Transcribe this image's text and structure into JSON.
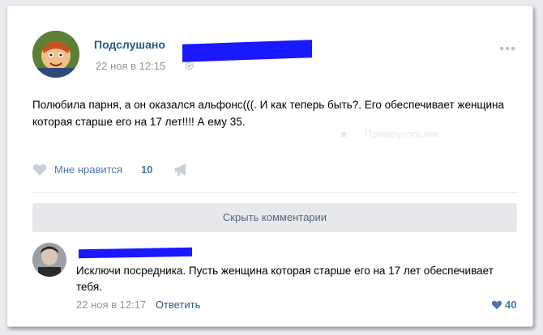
{
  "post": {
    "author": "Подслушано",
    "time": "22 ноя в 12:15",
    "text": "Полюбила парня, а он оказался альфонс(((. И как теперь быть?. Его обеспечивает женщина которая старше его на 17 лет!!!! А ему 35.",
    "ghost_text": "Прямоугольник",
    "likes_label": "Мне нравится",
    "likes_count": "10"
  },
  "comments": {
    "hide_label": "Скрыть комментарии",
    "item": {
      "text": "Исключи посредника. Пусть женщина которая старше его на 17 лет обеспечивает тебя.",
      "time": "22 ноя в 12:17",
      "reply_label": "Ответить",
      "likes_count": "40"
    }
  },
  "colors": {
    "link": "#2a5885",
    "like": "#4a76a8",
    "redaction": "#1919ff",
    "meta": "#939393"
  },
  "icons": [
    "gear-icon",
    "more-icon",
    "heart-icon",
    "megaphone-icon"
  ]
}
